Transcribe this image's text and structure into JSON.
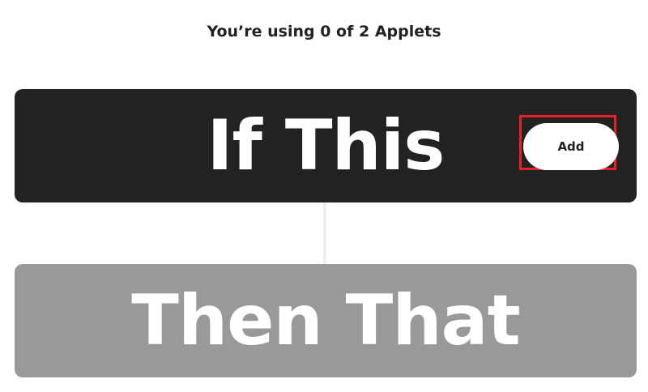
{
  "usage": {
    "text": "You’re using 0 of 2 Applets"
  },
  "trigger": {
    "title": "If This",
    "add_label": "Add"
  },
  "action": {
    "title": "Then That"
  },
  "colors": {
    "trigger_bg": "#222222",
    "action_bg": "#999999",
    "highlight": "#e8202a",
    "text_light": "#ffffff",
    "text_dark": "#222222"
  }
}
